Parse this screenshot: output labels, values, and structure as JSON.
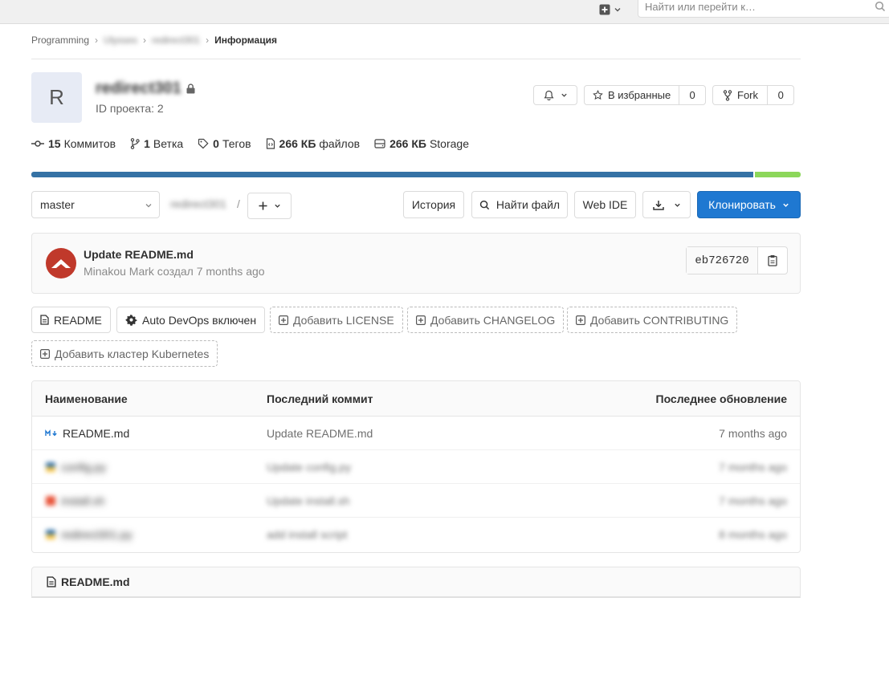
{
  "topbar": {
    "search_placeholder": "Найти или перейти к…"
  },
  "breadcrumb": {
    "group": "Programming",
    "subgroup": "Ulysses",
    "project": "redirect301",
    "current": "Информация"
  },
  "project": {
    "avatar_letter": "R",
    "name": "redirect301",
    "id_text": "ID проекта: 2"
  },
  "actions": {
    "star_label": "В избранные",
    "star_count": "0",
    "fork_label": "Fork",
    "fork_count": "0"
  },
  "stats": {
    "commits_count": "15",
    "commits_label": "Коммитов",
    "branches_count": "1",
    "branches_label": "Ветка",
    "tags_count": "0",
    "tags_label": "Тегов",
    "files_size": "266 КБ",
    "files_label": "файлов",
    "storage_size": "266 КБ",
    "storage_label": "Storage"
  },
  "languages": [
    {
      "color": "#3572a5",
      "percent": 94
    },
    {
      "color": "#8cd75a",
      "percent": 6
    }
  ],
  "toolbar": {
    "branch": "master",
    "repo_path": "redirect301",
    "path_sep": "/",
    "history": "История",
    "find_file": "Найти файл",
    "web_ide": "Web IDE",
    "clone": "Клонировать"
  },
  "last_commit": {
    "title": "Update README.md",
    "meta": "Minakou Mark создал 7 months ago",
    "sha": "eb726720"
  },
  "shortcuts": {
    "readme": "README",
    "autodevops": "Auto DevOps включен",
    "add_license": "Добавить LICENSE",
    "add_changelog": "Добавить CHANGELOG",
    "add_contributing": "Добавить CONTRIBUTING",
    "add_kubernetes": "Добавить кластер Kubernetes"
  },
  "file_table": {
    "headers": [
      "Наименование",
      "Последний коммит",
      "Последнее обновление"
    ],
    "rows": [
      {
        "name": "README.md",
        "commit": "Update README.md",
        "updated": "7 months ago"
      },
      {
        "name": "config.py",
        "commit": "Update config.py",
        "updated": "7 months ago"
      },
      {
        "name": "install.sh",
        "commit": "Update install.sh",
        "updated": "7 months ago"
      },
      {
        "name": "redirect301.py",
        "commit": "add install script",
        "updated": "8 months ago"
      }
    ]
  },
  "readme_panel": {
    "title": "README.md"
  }
}
